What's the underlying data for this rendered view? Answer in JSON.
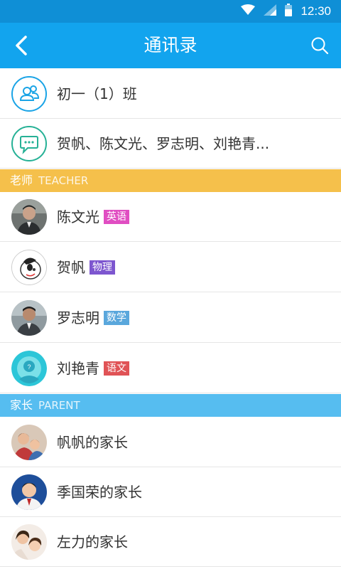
{
  "status_bar": {
    "time": "12:30",
    "icons": [
      "wifi-icon",
      "signal-icon",
      "battery-icon"
    ]
  },
  "app_bar": {
    "title": "通讯录",
    "back_icon": "chevron-left-icon",
    "search_icon": "search-icon"
  },
  "groups": [
    {
      "name": "初一（1）班",
      "icon": "group-icon"
    },
    {
      "name": "贺帆、陈文光、罗志明、刘艳青...",
      "icon": "chat-icon"
    }
  ],
  "teacher_section": {
    "label": "老师",
    "label_en": "TEACHER",
    "color": "#f5c04b"
  },
  "teachers": [
    {
      "name": "陈文光",
      "subject": "英语",
      "subject_color": "#e04ec2"
    },
    {
      "name": "贺帆",
      "subject": "物理",
      "subject_color": "#7d56cf"
    },
    {
      "name": "罗志明",
      "subject": "数学",
      "subject_color": "#5aa7dc"
    },
    {
      "name": "刘艳青",
      "subject": "语文",
      "subject_color": "#e05356"
    }
  ],
  "parent_section": {
    "label": "家长",
    "label_en": "PARENT",
    "color": "#56bdf0"
  },
  "parents": [
    {
      "name": "帆帆的家长"
    },
    {
      "name": "季国荣的家长"
    },
    {
      "name": "左力的家长"
    }
  ],
  "colors": {
    "status_bar": "#0f8fd6",
    "app_bar": "#12a4ee",
    "group_icon": "#1aa4e6",
    "chat_icon": "#26b196"
  }
}
